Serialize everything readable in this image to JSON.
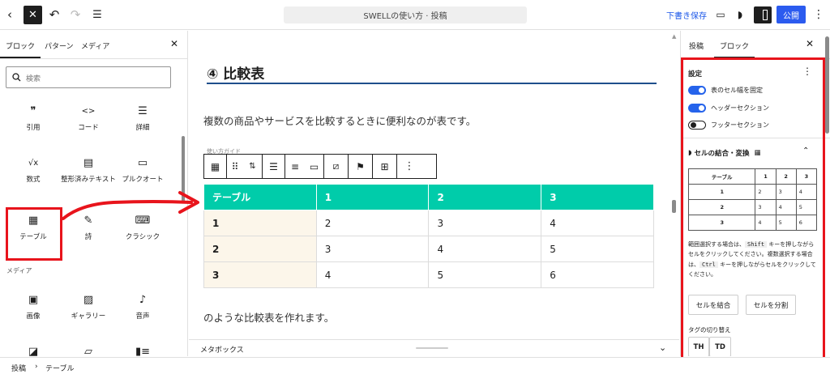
{
  "topbar": {
    "document_title": "SWELLの使い方 · 投稿",
    "save_draft_label": "下書き保存",
    "publish_label": "公開"
  },
  "inserter": {
    "tabs": [
      "ブロック",
      "パターン",
      "メディア"
    ],
    "search_placeholder": "検索",
    "blocks": [
      {
        "label": "引用",
        "icon": "quote-icon"
      },
      {
        "label": "コード",
        "icon": "code-icon"
      },
      {
        "label": "詳細",
        "icon": "details-icon"
      },
      {
        "label": "数式",
        "icon": "math-icon"
      },
      {
        "label": "整形済みテキスト",
        "icon": "preformatted-icon"
      },
      {
        "label": "プルクオート",
        "icon": "pullquote-icon"
      },
      {
        "label": "テーブル",
        "icon": "table-icon"
      },
      {
        "label": "詩",
        "icon": "verse-icon"
      },
      {
        "label": "クラシック",
        "icon": "classic-icon"
      }
    ],
    "media_section_label": "メディア",
    "media_blocks": [
      {
        "label": "画像",
        "icon": "image-icon"
      },
      {
        "label": "ギャラリー",
        "icon": "gallery-icon"
      },
      {
        "label": "音声",
        "icon": "audio-icon"
      }
    ]
  },
  "content": {
    "heading": "④ 比較表",
    "intro": "複数の商品やサービスを比較するときに便利なのが表です。",
    "caption_hint": "使い方ガイド",
    "table": {
      "header": [
        "テーブル",
        "1",
        "2",
        "3"
      ],
      "rows": [
        [
          "1",
          "2",
          "3",
          "4"
        ],
        [
          "2",
          "3",
          "4",
          "5"
        ],
        [
          "3",
          "4",
          "5",
          "6"
        ]
      ]
    },
    "outro": "のような比較表を作れます。",
    "metabox_label": "メタボックス"
  },
  "settings": {
    "tabs": [
      "投稿",
      "ブロック"
    ],
    "section_title": "設定",
    "toggles": [
      {
        "label": "表のセル幅を固定",
        "on": true
      },
      {
        "label": "ヘッダーセクション",
        "on": true
      },
      {
        "label": "フッターセクション",
        "on": false
      }
    ],
    "merge_title": "セルの結合・変換",
    "mini_table": {
      "header": [
        "テーブル",
        "1",
        "2",
        "3"
      ],
      "rows": [
        [
          "1",
          "2",
          "3",
          "4"
        ],
        [
          "2",
          "3",
          "4",
          "5"
        ],
        [
          "3",
          "4",
          "5",
          "6"
        ]
      ]
    },
    "help_text": {
      "p1": "範囲選択する場合は、",
      "key1": "Shift",
      "p2": " キーを押しながらセルをクリックしてください。複数選択する場合は、",
      "key2": "Ctrl",
      "p3": " キーを押しながらセルをクリックしてください。"
    },
    "merge_button": "セルを結合",
    "split_button": "セルを分割",
    "tag_switch_label": "タグの切り替え",
    "tag_th": "TH",
    "tag_td": "TD"
  },
  "breadcrumb": [
    "投稿",
    "テーブル"
  ],
  "colors": {
    "accent": "#2b5bef",
    "table_header": "#00ccaa",
    "row_header": "#fcf6ea",
    "annotation": "#e8141c",
    "heading_border": "#1f4f8c"
  }
}
